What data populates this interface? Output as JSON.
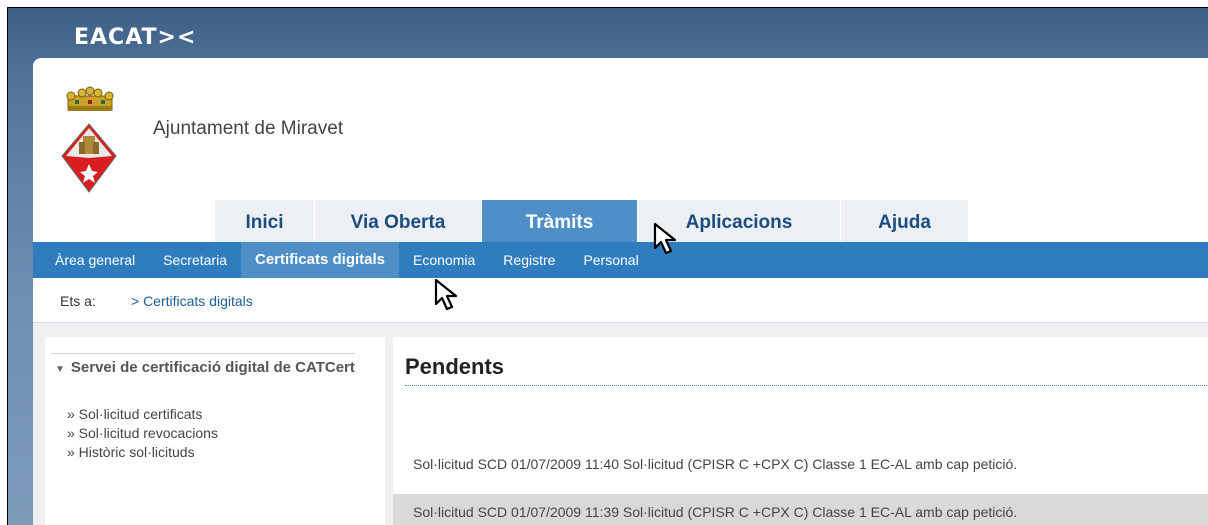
{
  "brand": {
    "logo_text": "EACAT><"
  },
  "org": {
    "name": "Ajuntament de Miravet"
  },
  "tabs": [
    {
      "label": "Inici",
      "active": false
    },
    {
      "label": "Via Oberta",
      "active": false
    },
    {
      "label": "Tràmits",
      "active": true
    },
    {
      "label": "Aplicacions",
      "active": false
    },
    {
      "label": "Ajuda",
      "active": false
    }
  ],
  "subnav": [
    {
      "label": "Àrea general",
      "active": false
    },
    {
      "label": "Secretaria",
      "active": false
    },
    {
      "label": "Certificats digitals",
      "active": true
    },
    {
      "label": "Economia",
      "active": false
    },
    {
      "label": "Registre",
      "active": false
    },
    {
      "label": "Personal",
      "active": false
    }
  ],
  "breadcrumb": {
    "label": "Ets a:",
    "link": "> Certificats digitals"
  },
  "sidebar": {
    "title": "Servei de certificació digital de CATCert",
    "items": [
      "» Sol·licitud certificats",
      "» Sol·licitud revocacions",
      "» Històric sol·licituds"
    ]
  },
  "main": {
    "heading": "Pendents",
    "rows": [
      "Sol·licitud SCD 01/07/2009 11:40 Sol·licitud (CPISR C +CPX C) Classe 1 EC-AL amb cap petició.",
      "Sol·licitud SCD 01/07/2009 11:39 Sol·licitud (CPISR C +CPX C) Classe 1 EC-AL amb cap petició."
    ]
  },
  "colors": {
    "accent": "#2f7dbf",
    "active_tab": "#4f8fc7",
    "header": "#3d5e84"
  }
}
